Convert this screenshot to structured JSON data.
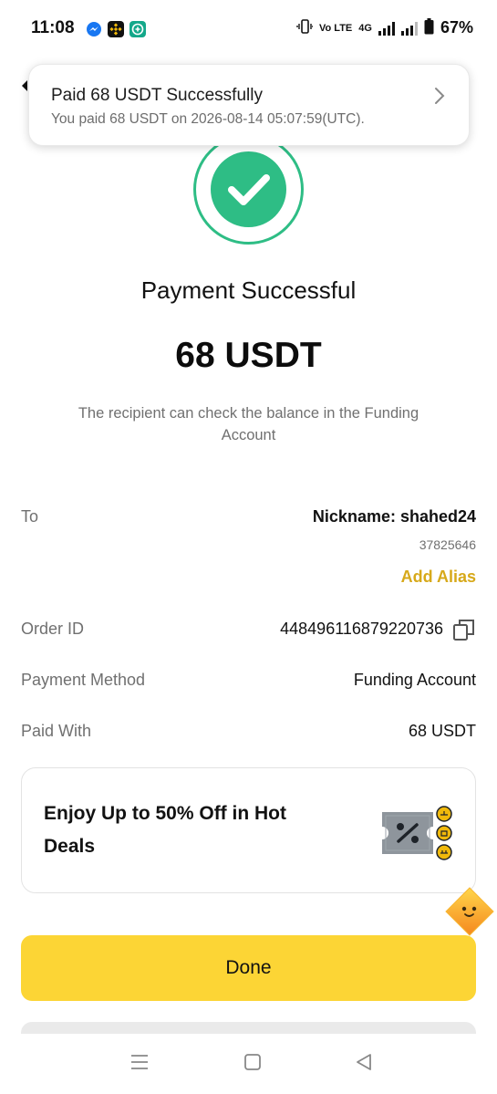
{
  "status_bar": {
    "time": "11:08",
    "network_labels": [
      "Vo LTE",
      "4G"
    ],
    "battery": "67%"
  },
  "notification": {
    "title": "Paid 68 USDT Successfully",
    "subtitle": "You paid 68 USDT on 2026-08-14 05:07:59(UTC)."
  },
  "payment": {
    "title": "Payment Successful",
    "amount": "68 USDT",
    "note": "The recipient can check the balance in the Funding Account"
  },
  "details": {
    "to_label": "To",
    "nickname": "Nickname: shahed24",
    "user_id": "37825646",
    "add_alias": "Add Alias",
    "order_label": "Order ID",
    "order_id": "448496116879220736",
    "method_label": "Payment Method",
    "method_value": "Funding Account",
    "paid_with_label": "Paid With",
    "paid_with_value": "68 USDT"
  },
  "promo": {
    "text": "Enjoy Up to 50% Off in Hot Deals"
  },
  "buttons": {
    "done": "Done"
  },
  "colors": {
    "success": "#2ebd85",
    "accent_yellow": "#fcd535",
    "alias_gold": "#d7a91a",
    "muted_text": "#707070"
  },
  "icons": [
    "messenger-icon",
    "binance-icon",
    "app-icon",
    "vibrate-icon",
    "signal-icon",
    "battery-icon",
    "chevron-right-icon",
    "checkmark-icon",
    "copy-icon",
    "coupon-icon",
    "mascot-icon",
    "menu-icon",
    "home-icon",
    "back-icon"
  ]
}
